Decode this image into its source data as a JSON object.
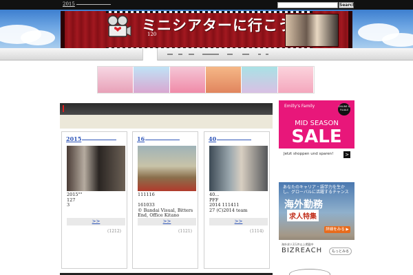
{
  "topbar": {
    "date_link": "2015",
    "search_placeholder": "",
    "search_label": "Search"
  },
  "header": {
    "title": "ミニシアターに行こう。",
    "count": "120"
  },
  "cards": [
    {
      "title": "2015",
      "text": "2015\"\"\n127\n3",
      "more": ">>",
      "views": "(1212)"
    },
    {
      "title": "16",
      "text": "111116\n\n161033\n© Bandai Visual, Bitters End, Office Kitano",
      "more": ">>",
      "views": "(1121)"
    },
    {
      "title": "40",
      "text": "40...\nPFF\n2014 111411\n27 (C)2014 team",
      "more": ">>",
      "views": "(1114)"
    }
  ],
  "side_ad_1": {
    "brand": "Emilly's Family",
    "badge": "ONLINE & FILIALE",
    "line1": "MID SEASON",
    "line2": "SALE",
    "foot": "Jetzt shoppen und sparen!",
    "arrow": ">"
  },
  "side_ad_2": {
    "t1": "あなたのキャリア・語学力を生かし、グローバルに活躍するチャンス",
    "t2": "海外勤務",
    "t3": "求人特集",
    "cta": "詳細をみる ▶",
    "small": "海外求人3万件以上掲載中",
    "brand": "BIZREACH",
    "more": "もっとみる"
  },
  "colors": {
    "link": "#2d54b8",
    "sale_pink": "#e8177a",
    "banner_red": "#7a0f14"
  }
}
